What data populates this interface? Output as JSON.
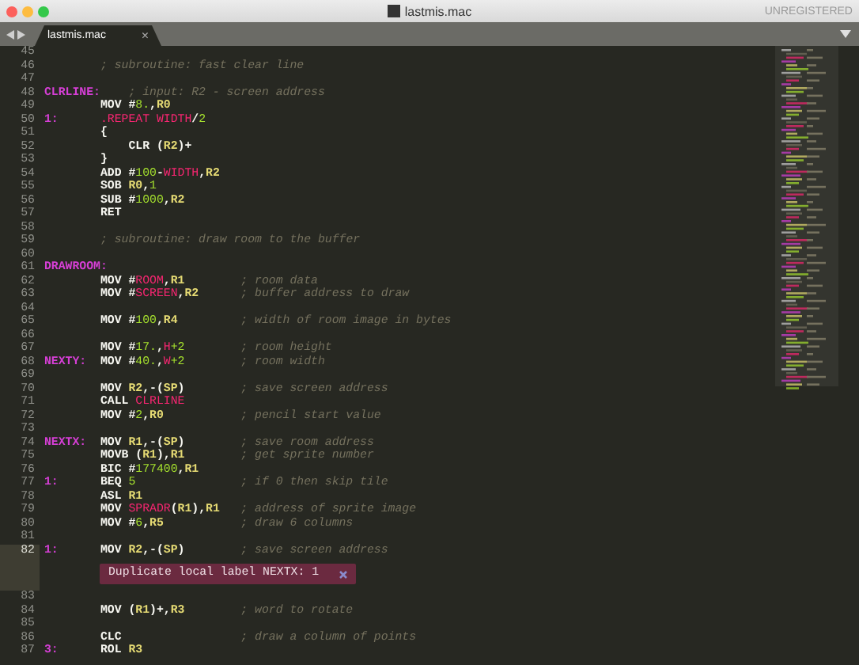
{
  "window": {
    "title": "lastmis.mac",
    "status": "UNREGISTERED"
  },
  "tabs": [
    {
      "label": "lastmis.mac",
      "selected": true,
      "close": "×"
    }
  ],
  "editor": {
    "lines": [
      {
        "number": "45",
        "current": false
      },
      {
        "number": "46",
        "current": false,
        "comment": "; subroutine: fast clear line"
      },
      {
        "number": "47",
        "current": false
      },
      {
        "number": "48",
        "current": false,
        "label": "CLRLINE:",
        "comment": "; input: R2 - screen address"
      },
      {
        "number": "49",
        "current": false,
        "code": [
          {
            "kind": "kw",
            "text": "MOV "
          },
          {
            "kind": "op",
            "text": "#"
          },
          {
            "kind": "num",
            "text": "8."
          },
          {
            "kind": "op",
            "text": ","
          },
          {
            "kind": "reg",
            "text": "R0"
          }
        ]
      },
      {
        "number": "50",
        "current": false,
        "label": "1:",
        "code": [
          {
            "kind": "sym",
            "text": ".REPEAT WIDTH"
          },
          {
            "kind": "op",
            "text": "/"
          },
          {
            "kind": "num",
            "text": "2"
          }
        ]
      },
      {
        "number": "51",
        "current": false,
        "code": [
          {
            "kind": "op",
            "text": "{"
          }
        ],
        "children": [
          {
            "number": "52",
            "current": false,
            "code": [
              {
                "kind": "kw",
                "text": "CLR "
              },
              {
                "kind": "op",
                "text": "("
              },
              {
                "kind": "reg",
                "text": "R2"
              },
              {
                "kind": "op",
                "text": ")+"
              }
            ]
          }
        ]
      },
      {
        "number": "53",
        "current": false,
        "code": [
          {
            "kind": "op",
            "text": "}"
          }
        ]
      },
      {
        "number": "54",
        "current": false,
        "code": [
          {
            "kind": "kw",
            "text": "ADD "
          },
          {
            "kind": "op",
            "text": "#"
          },
          {
            "kind": "num",
            "text": "100"
          },
          {
            "kind": "op",
            "text": "-"
          },
          {
            "kind": "sym",
            "text": "WIDTH"
          },
          {
            "kind": "op",
            "text": ","
          },
          {
            "kind": "reg",
            "text": "R2"
          }
        ]
      },
      {
        "number": "55",
        "current": false,
        "code": [
          {
            "kind": "kw",
            "text": "SOB "
          },
          {
            "kind": "reg",
            "text": "R0"
          },
          {
            "kind": "op",
            "text": ","
          },
          {
            "kind": "num",
            "text": "1"
          }
        ]
      },
      {
        "number": "56",
        "current": false,
        "code": [
          {
            "kind": "kw",
            "text": "SUB "
          },
          {
            "kind": "op",
            "text": "#"
          },
          {
            "kind": "num",
            "text": "1000"
          },
          {
            "kind": "op",
            "text": ","
          },
          {
            "kind": "reg",
            "text": "R2"
          }
        ]
      },
      {
        "number": "57",
        "current": false,
        "code": [
          {
            "kind": "kw",
            "text": "RET"
          }
        ]
      },
      {
        "number": "58",
        "current": false
      },
      {
        "number": "59",
        "current": false,
        "comment": "; subroutine: draw room to the buffer"
      },
      {
        "number": "60",
        "current": false
      },
      {
        "number": "61",
        "current": false,
        "label": "DRAWROOM:"
      },
      {
        "number": "62",
        "current": false,
        "code": [
          {
            "kind": "kw",
            "text": "MOV "
          },
          {
            "kind": "op",
            "text": "#"
          },
          {
            "kind": "sym",
            "text": "ROOM"
          },
          {
            "kind": "op",
            "text": ","
          },
          {
            "kind": "reg",
            "text": "R1"
          }
        ],
        "comment": "; room data"
      },
      {
        "number": "63",
        "current": false,
        "code": [
          {
            "kind": "kw",
            "text": "MOV "
          },
          {
            "kind": "op",
            "text": "#"
          },
          {
            "kind": "sym",
            "text": "SCREEN"
          },
          {
            "kind": "op",
            "text": ","
          },
          {
            "kind": "reg",
            "text": "R2"
          }
        ],
        "comment": "; buffer address to draw"
      },
      {
        "number": "64",
        "current": false
      },
      {
        "number": "65",
        "current": false,
        "code": [
          {
            "kind": "kw",
            "text": "MOV "
          },
          {
            "kind": "op",
            "text": "#"
          },
          {
            "kind": "num",
            "text": "100"
          },
          {
            "kind": "op",
            "text": ","
          },
          {
            "kind": "reg",
            "text": "R4"
          }
        ],
        "comment": "; width of room image in bytes"
      },
      {
        "number": "66",
        "current": false
      },
      {
        "number": "67",
        "current": false,
        "code": [
          {
            "kind": "kw",
            "text": "MOV "
          },
          {
            "kind": "op",
            "text": "#"
          },
          {
            "kind": "num",
            "text": "17."
          },
          {
            "kind": "op",
            "text": ","
          },
          {
            "kind": "sym",
            "text": "H"
          },
          {
            "kind": "num",
            "text": "+2"
          }
        ],
        "comment": "; room height"
      },
      {
        "number": "68",
        "current": false,
        "label": "NEXTY:",
        "code": [
          {
            "kind": "kw",
            "text": "MOV "
          },
          {
            "kind": "op",
            "text": "#"
          },
          {
            "kind": "num",
            "text": "40."
          },
          {
            "kind": "op",
            "text": ","
          },
          {
            "kind": "sym",
            "text": "W"
          },
          {
            "kind": "num",
            "text": "+2"
          }
        ],
        "comment": "; room width"
      },
      {
        "number": "69",
        "current": false
      },
      {
        "number": "70",
        "current": false,
        "code": [
          {
            "kind": "kw",
            "text": "MOV "
          },
          {
            "kind": "reg",
            "text": "R2"
          },
          {
            "kind": "op",
            "text": ",-("
          },
          {
            "kind": "reg",
            "text": "SP"
          },
          {
            "kind": "op",
            "text": ")"
          }
        ],
        "comment": "; save screen address"
      },
      {
        "number": "71",
        "current": false,
        "code": [
          {
            "kind": "kw",
            "text": "CALL "
          },
          {
            "kind": "sym",
            "text": "CLRLINE"
          }
        ]
      },
      {
        "number": "72",
        "current": false,
        "code": [
          {
            "kind": "kw",
            "text": "MOV "
          },
          {
            "kind": "op",
            "text": "#"
          },
          {
            "kind": "num",
            "text": "2"
          },
          {
            "kind": "op",
            "text": ","
          },
          {
            "kind": "reg",
            "text": "R0"
          }
        ],
        "comment": "; pencil start value"
      },
      {
        "number": "73",
        "current": false
      },
      {
        "number": "74",
        "current": false,
        "label": "NEXTX:",
        "code": [
          {
            "kind": "kw",
            "text": "MOV "
          },
          {
            "kind": "reg",
            "text": "R1"
          },
          {
            "kind": "op",
            "text": ",-("
          },
          {
            "kind": "reg",
            "text": "SP"
          },
          {
            "kind": "op",
            "text": ")"
          }
        ],
        "comment": "; save room address"
      },
      {
        "number": "75",
        "current": false,
        "code": [
          {
            "kind": "kw",
            "text": "MOVB "
          },
          {
            "kind": "op",
            "text": "("
          },
          {
            "kind": "reg",
            "text": "R1"
          },
          {
            "kind": "op",
            "text": "),"
          },
          {
            "kind": "reg",
            "text": "R1"
          }
        ],
        "comment": "; get sprite number"
      },
      {
        "number": "76",
        "current": false,
        "code": [
          {
            "kind": "kw",
            "text": "BIC "
          },
          {
            "kind": "op",
            "text": "#"
          },
          {
            "kind": "num",
            "text": "177400"
          },
          {
            "kind": "op",
            "text": ","
          },
          {
            "kind": "reg",
            "text": "R1"
          }
        ]
      },
      {
        "number": "77",
        "current": false,
        "label": "1:",
        "code": [
          {
            "kind": "kw",
            "text": "BEQ "
          },
          {
            "kind": "num",
            "text": "5"
          }
        ],
        "comment": "; if 0 then skip tile"
      },
      {
        "number": "78",
        "current": false,
        "code": [
          {
            "kind": "kw",
            "text": "ASL "
          },
          {
            "kind": "reg",
            "text": "R1"
          }
        ]
      },
      {
        "number": "79",
        "current": false,
        "code": [
          {
            "kind": "kw",
            "text": "MOV "
          },
          {
            "kind": "sym",
            "text": "SPRADR"
          },
          {
            "kind": "op",
            "text": "("
          },
          {
            "kind": "reg",
            "text": "R1"
          },
          {
            "kind": "op",
            "text": "),"
          },
          {
            "kind": "reg",
            "text": "R1"
          }
        ],
        "comment": "; address of sprite image"
      },
      {
        "number": "80",
        "current": false,
        "code": [
          {
            "kind": "kw",
            "text": "MOV "
          },
          {
            "kind": "op",
            "text": "#"
          },
          {
            "kind": "num",
            "text": "6"
          },
          {
            "kind": "op",
            "text": ","
          },
          {
            "kind": "reg",
            "text": "R5"
          }
        ],
        "comment": "; draw 6 columns"
      },
      {
        "number": "81",
        "current": false
      },
      {
        "number": "82",
        "current": true,
        "label": "1:",
        "code": [
          {
            "kind": "kw",
            "text": "MOV "
          },
          {
            "kind": "reg",
            "text": "R2"
          },
          {
            "kind": "op",
            "text": ",-("
          },
          {
            "kind": "reg",
            "text": "SP"
          },
          {
            "kind": "op",
            "text": ")"
          }
        ],
        "comment": "; save screen address",
        "annotation": "Duplicate local label NEXTX: 1"
      },
      {
        "number": "83",
        "current": false
      },
      {
        "number": "84",
        "current": false,
        "code": [
          {
            "kind": "kw",
            "text": "MOV "
          },
          {
            "kind": "op",
            "text": "("
          },
          {
            "kind": "reg",
            "text": "R1"
          },
          {
            "kind": "op",
            "text": ")+,"
          },
          {
            "kind": "reg",
            "text": "R3"
          }
        ],
        "comment": "; word to rotate"
      },
      {
        "number": "85",
        "current": false
      },
      {
        "number": "86",
        "current": false,
        "code": [
          {
            "kind": "kw",
            "text": "CLC"
          }
        ],
        "comment": "; draw a column of points"
      },
      {
        "number": "87",
        "current": false,
        "label": "3:",
        "code": [
          {
            "kind": "kw",
            "text": "ROL "
          },
          {
            "kind": "reg",
            "text": "R3"
          }
        ]
      }
    ]
  }
}
